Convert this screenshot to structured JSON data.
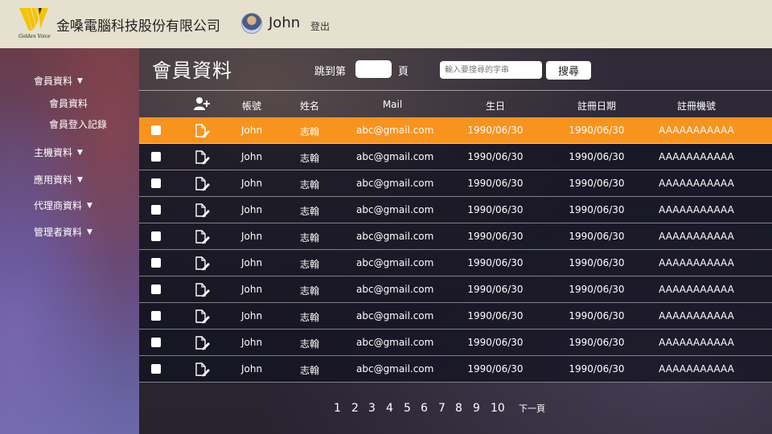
{
  "header": {
    "logo_text": "Golden Voice",
    "company": "金嗓電腦科技股份有限公司",
    "username": "John",
    "logout": "登出"
  },
  "sidebar": {
    "items": [
      {
        "label": "會員資料"
      },
      {
        "label": "會員資料"
      },
      {
        "label": "會員登入記錄"
      },
      {
        "label": "主機資料"
      },
      {
        "label": "應用資料"
      },
      {
        "label": "代理商資料"
      },
      {
        "label": "管理者資料"
      }
    ],
    "caret": "▼"
  },
  "main": {
    "title": "會員資料",
    "jump_label": "跳到第",
    "page_unit": "頁",
    "search_placeholder": "輸入要搜尋的字串",
    "search_button": "搜尋"
  },
  "table": {
    "columns": [
      "帳號",
      "姓名",
      "Mail",
      "生日",
      "註冊日期",
      "註冊機號"
    ],
    "rows": [
      [
        "John",
        "志翰",
        "abc@gmail.com",
        "1990/06/30",
        "1990/06/30",
        "AAAAAAAAAAA"
      ],
      [
        "John",
        "志翰",
        "abc@gmail.com",
        "1990/06/30",
        "1990/06/30",
        "AAAAAAAAAAA"
      ],
      [
        "John",
        "志翰",
        "abc@gmail.com",
        "1990/06/30",
        "1990/06/30",
        "AAAAAAAAAAA"
      ],
      [
        "John",
        "志翰",
        "abc@gmail.com",
        "1990/06/30",
        "1990/06/30",
        "AAAAAAAAAAA"
      ],
      [
        "John",
        "志翰",
        "abc@gmail.com",
        "1990/06/30",
        "1990/06/30",
        "AAAAAAAAAAA"
      ],
      [
        "John",
        "志翰",
        "abc@gmail.com",
        "1990/06/30",
        "1990/06/30",
        "AAAAAAAAAAA"
      ],
      [
        "John",
        "志翰",
        "abc@gmail.com",
        "1990/06/30",
        "1990/06/30",
        "AAAAAAAAAAA"
      ],
      [
        "John",
        "志翰",
        "abc@gmail.com",
        "1990/06/30",
        "1990/06/30",
        "AAAAAAAAAAA"
      ],
      [
        "John",
        "志翰",
        "abc@gmail.com",
        "1990/06/30",
        "1990/06/30",
        "AAAAAAAAAAA"
      ],
      [
        "John",
        "志翰",
        "abc@gmail.com",
        "1990/06/30",
        "1990/06/30",
        "AAAAAAAAAAA"
      ]
    ],
    "highlight_color": "#f8931d"
  },
  "pagination": {
    "pages": [
      "1",
      "2",
      "3",
      "4",
      "5",
      "6",
      "7",
      "8",
      "9",
      "10"
    ],
    "next": "下一頁"
  },
  "icons": {
    "add_user": "add-user-icon",
    "edit": "edit-document-icon",
    "logo": "golden-voice-logo"
  }
}
